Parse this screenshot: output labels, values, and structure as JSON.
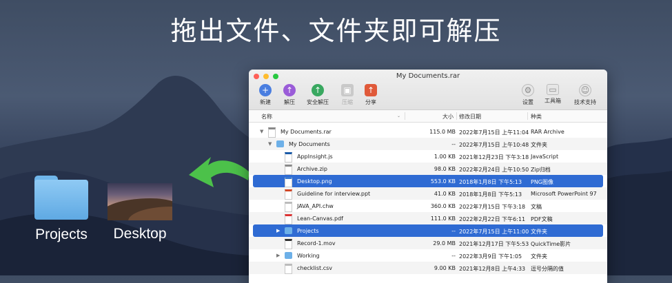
{
  "headline": "拖出文件、文件夹即可解压",
  "desktop_items": [
    {
      "label": "Projects",
      "icon": "folder-icon"
    },
    {
      "label": "Desktop",
      "icon": "image-thumbnail"
    }
  ],
  "window": {
    "title": "My Documents.rar",
    "toolbar_left": [
      {
        "label": "新建",
        "icon": "plus-icon",
        "color": "#4a7ee0",
        "enabled": true
      },
      {
        "label": "解压",
        "icon": "extract-icon",
        "color": "#9a5cd8",
        "enabled": true
      },
      {
        "label": "安全解压",
        "icon": "shield-icon",
        "color": "#39a860",
        "enabled": true
      },
      {
        "label": "压缩",
        "icon": "compress-icon",
        "color": "#c9c9c9",
        "enabled": false
      },
      {
        "label": "分享",
        "icon": "share-icon",
        "color": "#e05a3a",
        "enabled": true
      }
    ],
    "toolbar_right": [
      {
        "label": "设置",
        "icon": "gear-icon"
      },
      {
        "label": "工具箱",
        "icon": "toolbox-icon"
      },
      {
        "label": "技术支持",
        "icon": "support-icon"
      }
    ],
    "columns": {
      "name": "名称",
      "size": "大小",
      "modified": "修改日期",
      "kind": "种类"
    },
    "rows": [
      {
        "name": "My Documents.rar",
        "size": "115.0 MB",
        "date": "2022年7月15日 上午11:04",
        "kind": "RAR Archive",
        "indent": 0,
        "expand": "open",
        "icon": "archive-icon",
        "selected": false
      },
      {
        "name": "My Documents",
        "size": "--",
        "date": "2022年7月15日 上午10:48",
        "kind": "文件夹",
        "indent": 1,
        "expand": "open",
        "icon": "folder-icon",
        "selected": false
      },
      {
        "name": "AppInsight.js",
        "size": "1.00 KB",
        "date": "2021年12月23日 下午3:18",
        "kind": "JavaScript",
        "indent": 2,
        "expand": "",
        "icon": "js-file-icon",
        "selected": false
      },
      {
        "name": "Archive.zip",
        "size": "98.0 KB",
        "date": "2022年2月24日 上午10:50",
        "kind": "Zip归档",
        "indent": 2,
        "expand": "",
        "icon": "zip-file-icon",
        "selected": false
      },
      {
        "name": "Desktop.png",
        "size": "553.0 KB",
        "date": "2018年1月8日 下午5:13",
        "kind": "PNG图像",
        "indent": 2,
        "expand": "",
        "icon": "png-file-icon",
        "selected": true
      },
      {
        "name": "Guideline for interview.ppt",
        "size": "41.0 KB",
        "date": "2018年1月8日 下午5:13",
        "kind": "Microsoft PowerPoint 97",
        "indent": 2,
        "expand": "",
        "icon": "ppt-file-icon",
        "selected": false
      },
      {
        "name": "JAVA_API.chw",
        "size": "360.0 KB",
        "date": "2022年7月15日 下午3:18",
        "kind": "文稿",
        "indent": 2,
        "expand": "",
        "icon": "doc-file-icon",
        "selected": false
      },
      {
        "name": "Lean-Canvas.pdf",
        "size": "111.0 KB",
        "date": "2022年2月22日 下午6:11",
        "kind": "PDF文稿",
        "indent": 2,
        "expand": "",
        "icon": "pdf-file-icon",
        "selected": false
      },
      {
        "name": "Projects",
        "size": "--",
        "date": "2022年7月15日 上午11:00",
        "kind": "文件夹",
        "indent": 2,
        "expand": "closed",
        "icon": "folder-icon",
        "selected": true
      },
      {
        "name": "Record-1.mov",
        "size": "29.0 MB",
        "date": "2021年12月17日 下午5:53",
        "kind": "QuickTime影片",
        "indent": 2,
        "expand": "",
        "icon": "mov-file-icon",
        "selected": false
      },
      {
        "name": "Working",
        "size": "--",
        "date": "2022年3月9日 下午1:05",
        "kind": "文件夹",
        "indent": 2,
        "expand": "closed",
        "icon": "folder-icon",
        "selected": false
      },
      {
        "name": "checklist.csv",
        "size": "9.00 KB",
        "date": "2021年12月8日 上午4:33",
        "kind": "逗号分隔的值",
        "indent": 2,
        "expand": "",
        "icon": "csv-file-icon",
        "selected": false
      }
    ]
  },
  "colors": {
    "selection": "#2f6bd3",
    "arrow": "#4cc14a"
  }
}
